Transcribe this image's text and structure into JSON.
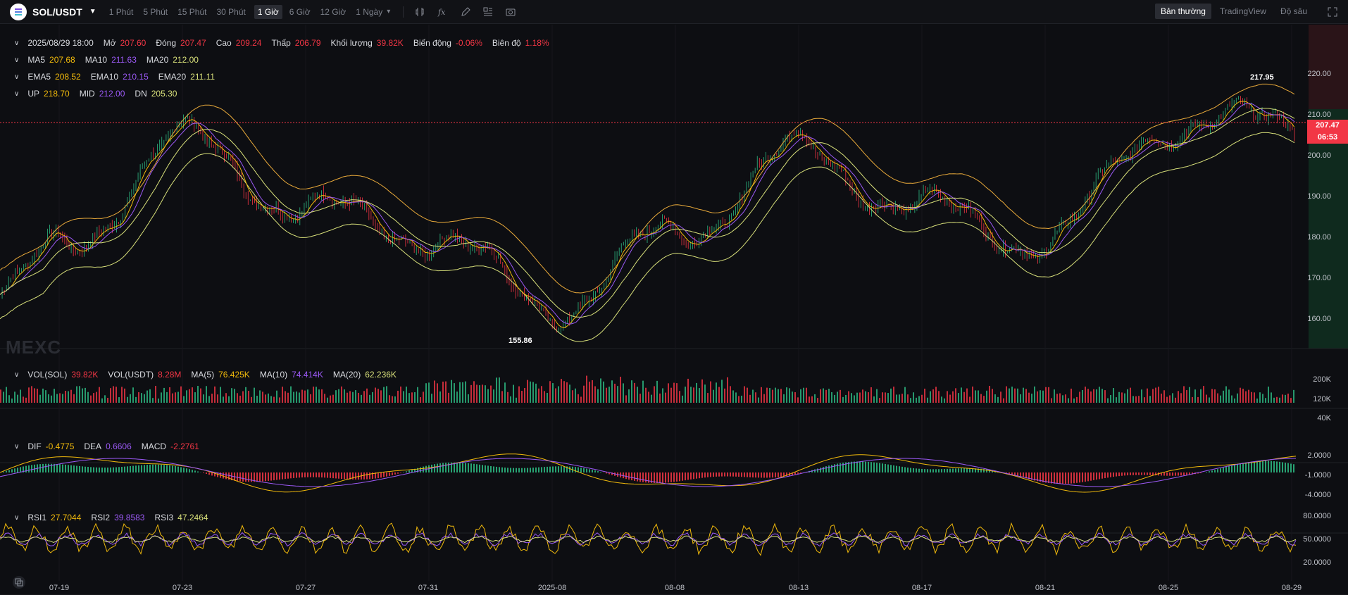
{
  "header": {
    "pair": "SOL/USDT",
    "timeframes": [
      "1 Phút",
      "5 Phút",
      "15 Phút",
      "30 Phút",
      "1 Giờ",
      "6 Giờ",
      "12 Giờ",
      "1 Ngày"
    ],
    "active_timeframe": "1 Giờ",
    "views": [
      "Bản thường",
      "TradingView",
      "Độ sâu"
    ],
    "active_view": "Bản thường"
  },
  "ohlc": {
    "time": "2025/08/29 18:00",
    "open_label": "Mở",
    "open": "207.60",
    "close_label": "Đóng",
    "close": "207.47",
    "high_label": "Cao",
    "high": "209.24",
    "low_label": "Thấp",
    "low": "206.79",
    "vol_label": "Khối lượng",
    "vol": "39.82K",
    "change_label": "Biến động",
    "change": "-0.06%",
    "amp_label": "Biên độ",
    "amp": "1.18%"
  },
  "ma": {
    "ma5_label": "MA5",
    "ma5": "207.68",
    "ma10_label": "MA10",
    "ma10": "211.63",
    "ma20_label": "MA20",
    "ma20": "212.00"
  },
  "ema": {
    "ema5_label": "EMA5",
    "ema5": "208.52",
    "ema10_label": "EMA10",
    "ema10": "210.15",
    "ema20_label": "EMA20",
    "ema20": "211.11"
  },
  "boll": {
    "up_label": "UP",
    "up": "218.70",
    "mid_label": "MID",
    "mid": "212.00",
    "dn_label": "DN",
    "dn": "205.30"
  },
  "volume": {
    "sol_label": "VOL(SOL)",
    "sol": "39.82K",
    "usdt_label": "VOL(USDT)",
    "usdt": "8.28M",
    "ma5_label": "MA(5)",
    "ma5": "76.425K",
    "ma10_label": "MA(10)",
    "ma10": "74.414K",
    "ma20_label": "MA(20)",
    "ma20": "62.236K"
  },
  "macd": {
    "dif_label": "DIF",
    "dif": "-0.4775",
    "dea_label": "DEA",
    "dea": "0.6606",
    "macd_label": "MACD",
    "macd": "-2.2761"
  },
  "rsi": {
    "rsi1_label": "RSI1",
    "rsi1": "27.7044",
    "rsi2_label": "RSI2",
    "rsi2": "39.8583",
    "rsi3_label": "RSI3",
    "rsi3": "47.2464"
  },
  "watermark": "MEXC",
  "price_axis": [
    "220.00",
    "210.00",
    "200.00",
    "190.00",
    "180.00",
    "170.00",
    "160.00"
  ],
  "volume_axis": [
    "200K",
    "120K",
    "40K"
  ],
  "macd_axis": [
    "2.0000",
    "-1.0000",
    "-4.0000"
  ],
  "rsi_axis": [
    "80.0000",
    "50.0000",
    "20.0000"
  ],
  "last_price": "207.47",
  "countdown": "06:53",
  "high_marker": "217.95",
  "low_marker": "155.86",
  "x_axis": [
    "07-19",
    "07-23",
    "07-27",
    "07-31",
    "2025-08",
    "08-08",
    "08-13",
    "08-17",
    "08-21",
    "08-25",
    "08-29"
  ],
  "colors": {
    "up": "#2ebd85",
    "down": "#f23645",
    "ma5": "#f0b90b",
    "ma10": "#9b59f5",
    "ma20": "#d8e07a",
    "boll": "#e8a93a",
    "accent": "#f23645"
  },
  "chart_data": {
    "type": "line",
    "title": "SOL/USDT 1h",
    "x": [
      "07-19",
      "07-23",
      "07-27",
      "07-31",
      "2025-08",
      "08-08",
      "08-13",
      "08-17",
      "08-21",
      "08-25",
      "08-29"
    ],
    "series": [
      {
        "name": "close",
        "values": [
          176,
          203,
          186,
          180,
          162,
          180,
          200,
          186,
          178,
          207,
          207.47
        ]
      }
    ],
    "ylim": [
      155,
      225
    ],
    "annotations": {
      "high": 217.95,
      "low": 155.86
    }
  }
}
